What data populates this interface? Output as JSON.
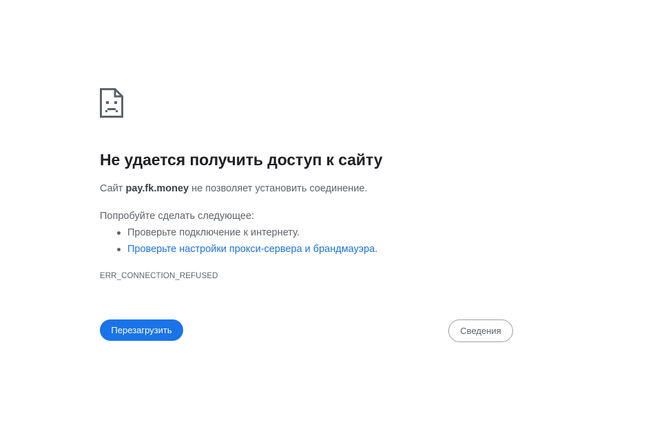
{
  "error_page": {
    "icon": "sad-page-icon",
    "title": "Не удается получить доступ к сайту",
    "description": {
      "prefix": "Сайт",
      "host": "pay.fk.money",
      "suffix": "не позволяет установить соединение."
    },
    "try_label": "Попробуйте сделать следующее:",
    "suggestions": [
      {
        "text": "Проверьте подключение к интернету.",
        "trail": ""
      },
      {
        "text": "Проверьте настройки прокси-сервера и брандмауэра",
        "trail": "."
      }
    ],
    "error_code": "ERR_CONNECTION_REFUSED",
    "reload_label": "Перезагрузить",
    "details_label": "Сведения"
  },
  "colors": {
    "accent": "#1a73e8",
    "text_primary": "#202124",
    "text_secondary": "#5f6368",
    "border": "#9aa0a6"
  }
}
